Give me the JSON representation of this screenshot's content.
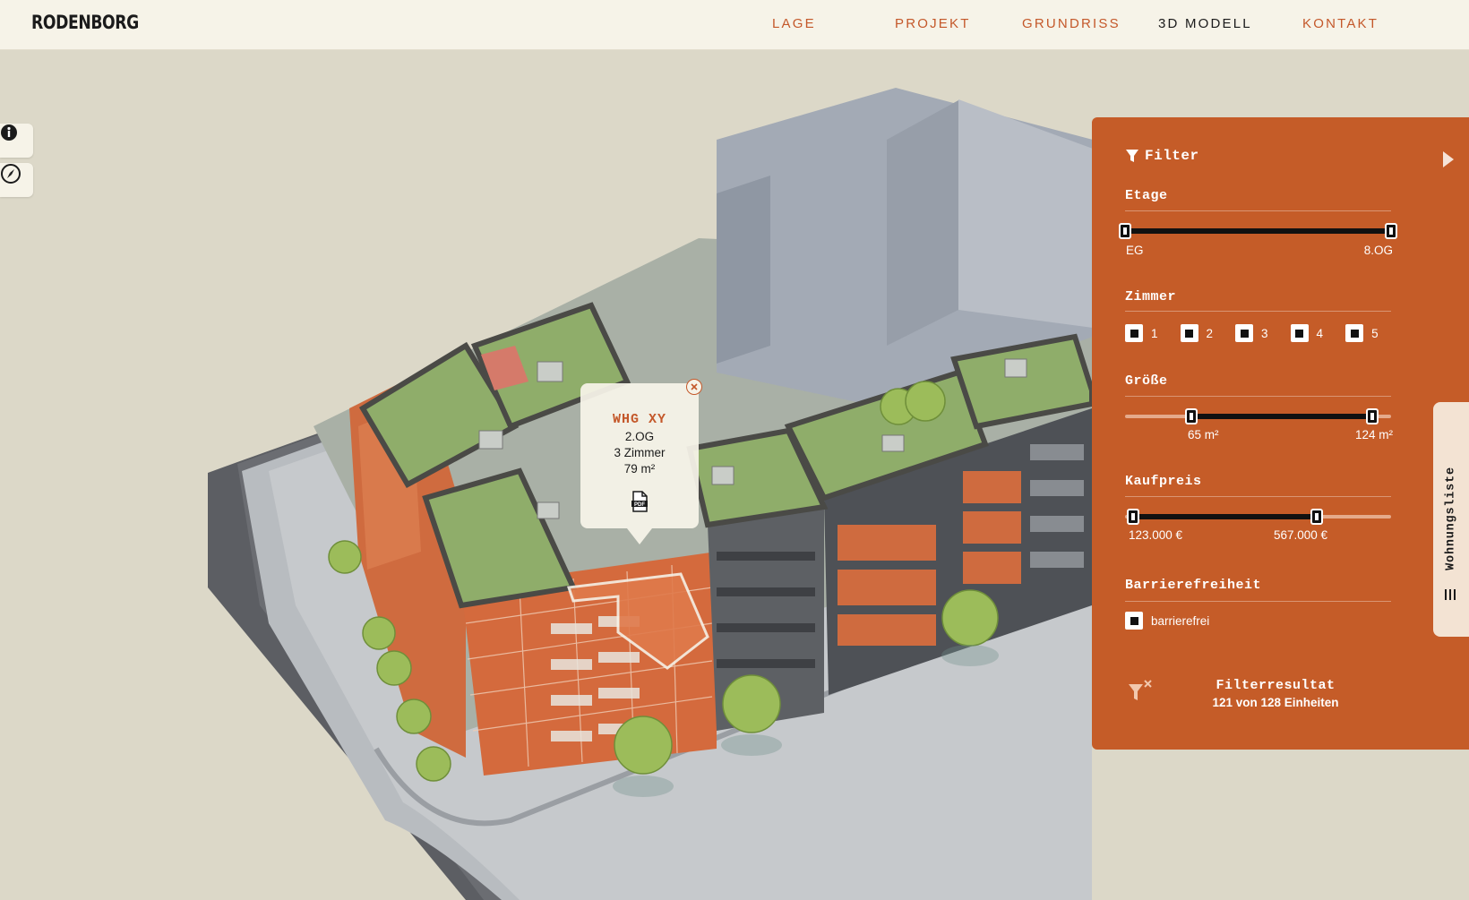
{
  "header": {
    "logo": "RODENBORG",
    "nav": [
      {
        "label": "LAGE",
        "active": false
      },
      {
        "label": "PROJEKT",
        "active": false
      },
      {
        "label": "GRUNDRISS",
        "active": false
      },
      {
        "label": "3D MODELL",
        "active": true
      },
      {
        "label": "KONTAKT",
        "active": false
      }
    ]
  },
  "tools": {
    "info_icon": "info-icon",
    "compass_icon": "compass-icon"
  },
  "popup": {
    "title": "WHG XY",
    "floor": "2.OG",
    "rooms": "3 Zimmer",
    "size": "79 m²",
    "pdf_icon": "pdf-icon",
    "close_icon": "close-icon"
  },
  "filter": {
    "title": "Filter",
    "etage": {
      "label": "Etage",
      "min_label": "EG",
      "max_label": "8.OG",
      "range": [
        0,
        1
      ]
    },
    "zimmer": {
      "label": "Zimmer",
      "options": [
        "1",
        "2",
        "3",
        "4",
        "5"
      ]
    },
    "groesse": {
      "label": "Größe",
      "min_label": "65 m²",
      "max_label": "124 m²",
      "range": [
        0.25,
        0.93
      ]
    },
    "kaufpreis": {
      "label": "Kaufpreis",
      "min_label": "123.000 €",
      "max_label": "567.000 €",
      "range": [
        0.03,
        0.72
      ]
    },
    "barriere": {
      "label": "Barrierefreiheit",
      "option": "barrierefrei"
    },
    "result_title": "Filterresultat",
    "result_count": "121 von 128 Einheiten"
  },
  "wohnungsliste": {
    "label": "Wohnungsliste"
  },
  "colors": {
    "accent": "#c55c28",
    "background": "#dcd8c8",
    "header_bg": "#f6f3e8",
    "facade_orange": "#d76a3c",
    "roof_green": "#8fad6a"
  }
}
